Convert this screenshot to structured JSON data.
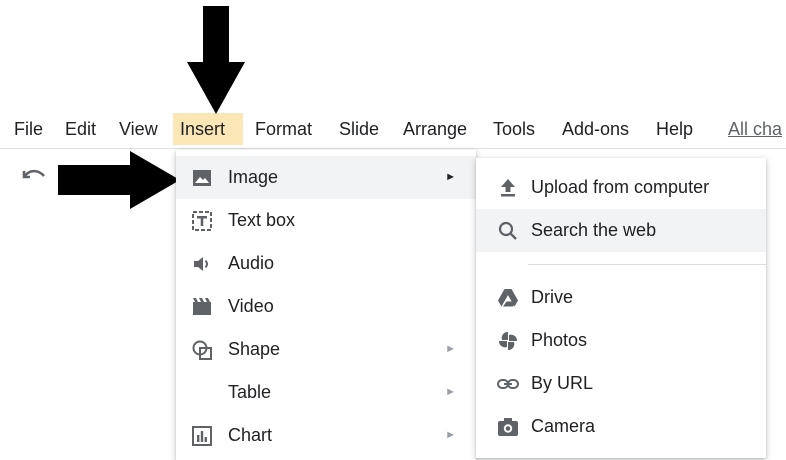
{
  "menubar": {
    "items": [
      "File",
      "Edit",
      "View",
      "Insert",
      "Format",
      "Slide",
      "Arrange",
      "Tools",
      "Add-ons",
      "Help",
      "All cha"
    ],
    "active_index": 3
  },
  "insert_menu": {
    "items": [
      {
        "label": "Image",
        "icon": "image-icon",
        "has_submenu": true,
        "highlighted": true
      },
      {
        "label": "Text box",
        "icon": "text-box-icon",
        "has_submenu": false
      },
      {
        "label": "Audio",
        "icon": "audio-icon",
        "has_submenu": false
      },
      {
        "label": "Video",
        "icon": "video-icon",
        "has_submenu": false
      },
      {
        "label": "Shape",
        "icon": "shape-icon",
        "has_submenu": true
      },
      {
        "label": "Table",
        "icon": "",
        "has_submenu": true
      },
      {
        "label": "Chart",
        "icon": "chart-icon",
        "has_submenu": true
      }
    ],
    "submenu_caret": "►"
  },
  "image_submenu": {
    "items": [
      {
        "label": "Upload from computer",
        "icon": "upload-icon"
      },
      {
        "label": "Search the web",
        "icon": "search-icon",
        "highlighted": true
      },
      {
        "label": "Drive",
        "icon": "drive-icon"
      },
      {
        "label": "Photos",
        "icon": "photos-icon"
      },
      {
        "label": "By URL",
        "icon": "link-icon"
      },
      {
        "label": "Camera",
        "icon": "camera-icon"
      }
    ]
  },
  "colors": {
    "active_menu_bg": "#fbe7b5",
    "highlight_bg": "#f1f3f4",
    "icon": "#5f6368",
    "arrow": "#000000"
  }
}
